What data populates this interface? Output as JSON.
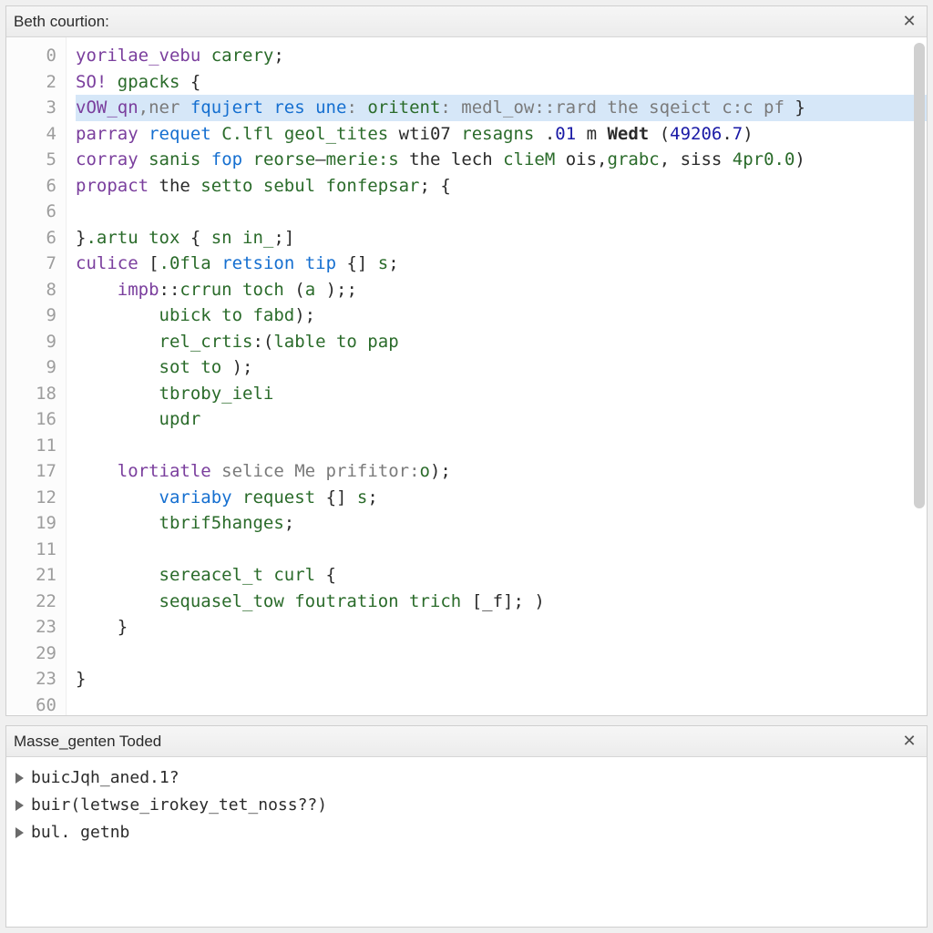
{
  "editor": {
    "title": "Beth courtion:",
    "gutter": [
      "0",
      "2",
      "3",
      "4",
      "5",
      "6",
      "6",
      "6",
      "7",
      "8",
      "9",
      "9",
      "9",
      "18",
      "16",
      "11",
      "17",
      "12",
      "19",
      "11",
      "21",
      "22",
      "23",
      "29",
      "23",
      "60"
    ],
    "lines": [
      {
        "indent": 0,
        "selected": false,
        "tokens": [
          [
            "kw",
            "yorilae_vebu"
          ],
          [
            "op",
            " "
          ],
          [
            "fn",
            "carery"
          ],
          [
            "op",
            ";"
          ]
        ]
      },
      {
        "indent": 0,
        "selected": false,
        "tokens": [
          [
            "kw",
            "SO!"
          ],
          [
            "op",
            " "
          ],
          [
            "fn",
            "gpacks"
          ],
          [
            "op",
            " {"
          ]
        ]
      },
      {
        "indent": 0,
        "selected": true,
        "tokens": [
          [
            "kw",
            "vOW_qn"
          ],
          [
            "cm",
            ",ner "
          ],
          [
            "blue",
            "fqujert res une"
          ],
          [
            "cm",
            ": "
          ],
          [
            "fn",
            "oritent"
          ],
          [
            "cm",
            ": medl_ow::rard the sqeict c:c pf "
          ],
          [
            "op",
            "}"
          ]
        ]
      },
      {
        "indent": 0,
        "selected": false,
        "tokens": [
          [
            "kw",
            "parray"
          ],
          [
            "op",
            " "
          ],
          [
            "blue",
            "requet"
          ],
          [
            "op",
            " "
          ],
          [
            "fn",
            "C.lfl geol_tites"
          ],
          [
            "op",
            " wti07 "
          ],
          [
            "fn",
            "resagns"
          ],
          [
            "op",
            " ."
          ],
          [
            "num",
            "01"
          ],
          [
            "op",
            " m "
          ],
          [
            "bold",
            "Wedt"
          ],
          [
            "op",
            " ("
          ],
          [
            "num",
            "49206"
          ],
          [
            "op",
            "."
          ],
          [
            "num",
            "7"
          ],
          [
            "op",
            ")"
          ]
        ]
      },
      {
        "indent": 0,
        "selected": false,
        "tokens": [
          [
            "kw",
            "corray"
          ],
          [
            "op",
            " "
          ],
          [
            "fn",
            "sanis"
          ],
          [
            "op",
            " "
          ],
          [
            "blue",
            "fop"
          ],
          [
            "op",
            " "
          ],
          [
            "fn",
            "reorse"
          ],
          [
            "op",
            "—"
          ],
          [
            "fn",
            "merie:s"
          ],
          [
            "op",
            " the lech "
          ],
          [
            "fn",
            "clieM"
          ],
          [
            "op",
            " ois,"
          ],
          [
            "fn",
            "grabc"
          ],
          [
            "op",
            ", siss "
          ],
          [
            "fn",
            "4pr0.0"
          ],
          [
            "op",
            ")"
          ]
        ]
      },
      {
        "indent": 0,
        "selected": false,
        "tokens": [
          [
            "kw",
            "propact"
          ],
          [
            "op",
            " the "
          ],
          [
            "fn",
            "setto sebul fonfepsar"
          ],
          [
            "op",
            "; {"
          ]
        ]
      },
      {
        "indent": 0,
        "selected": false,
        "tokens": [
          [
            "op",
            ""
          ]
        ]
      },
      {
        "indent": 0,
        "selected": false,
        "tokens": [
          [
            "op",
            "}"
          ],
          [
            "fn",
            ".artu tox"
          ],
          [
            "op",
            " { "
          ],
          [
            "fn",
            "sn in_"
          ],
          [
            "op",
            ";]"
          ]
        ]
      },
      {
        "indent": 0,
        "selected": false,
        "tokens": [
          [
            "kw",
            "culice"
          ],
          [
            "op",
            " ["
          ],
          [
            "fn",
            ".0fla"
          ],
          [
            "op",
            " "
          ],
          [
            "blue",
            "retsion tip"
          ],
          [
            "op",
            " {] "
          ],
          [
            "fn",
            "s"
          ],
          [
            "op",
            ";"
          ]
        ]
      },
      {
        "indent": 1,
        "selected": false,
        "tokens": [
          [
            "kw",
            "impb"
          ],
          [
            "op",
            "::"
          ],
          [
            "fn",
            "crrun toch"
          ],
          [
            "op",
            " ("
          ],
          [
            "fn",
            "a"
          ],
          [
            "op",
            " );;"
          ]
        ]
      },
      {
        "indent": 2,
        "selected": false,
        "tokens": [
          [
            "fn",
            "ubick to fabd"
          ],
          [
            "op",
            ");"
          ]
        ]
      },
      {
        "indent": 2,
        "selected": false,
        "tokens": [
          [
            "fn",
            "rel_crtis"
          ],
          [
            "op",
            ":("
          ],
          [
            "fn",
            "lable to pap"
          ]
        ]
      },
      {
        "indent": 2,
        "selected": false,
        "tokens": [
          [
            "fn",
            "sot to"
          ],
          [
            "op",
            " );"
          ]
        ]
      },
      {
        "indent": 2,
        "selected": false,
        "tokens": [
          [
            "fn",
            "tbroby_ieli"
          ]
        ]
      },
      {
        "indent": 2,
        "selected": false,
        "tokens": [
          [
            "fn",
            "updr"
          ]
        ]
      },
      {
        "indent": 0,
        "selected": false,
        "tokens": [
          [
            "op",
            ""
          ]
        ]
      },
      {
        "indent": 1,
        "selected": false,
        "tokens": [
          [
            "kw",
            "lortiatle"
          ],
          [
            "op",
            " "
          ],
          [
            "cm",
            "selice Me prifitor:"
          ],
          [
            "fn",
            "o"
          ],
          [
            "op",
            ");"
          ]
        ]
      },
      {
        "indent": 2,
        "selected": false,
        "tokens": [
          [
            "blue",
            "variaby"
          ],
          [
            "op",
            " "
          ],
          [
            "fn",
            "request"
          ],
          [
            "op",
            " {] "
          ],
          [
            "fn",
            "s"
          ],
          [
            "op",
            ";"
          ]
        ]
      },
      {
        "indent": 2,
        "selected": false,
        "tokens": [
          [
            "fn",
            "tbrif5hanges"
          ],
          [
            "op",
            ";"
          ]
        ]
      },
      {
        "indent": 0,
        "selected": false,
        "tokens": [
          [
            "op",
            ""
          ]
        ]
      },
      {
        "indent": 2,
        "selected": false,
        "tokens": [
          [
            "fn",
            "sereacel_t curl"
          ],
          [
            "op",
            " {"
          ]
        ]
      },
      {
        "indent": 2,
        "selected": false,
        "tokens": [
          [
            "fn",
            "sequasel_tow foutration trich"
          ],
          [
            "op",
            " [_f]; )"
          ]
        ]
      },
      {
        "indent": 1,
        "selected": false,
        "tokens": [
          [
            "op",
            "}"
          ]
        ]
      },
      {
        "indent": 0,
        "selected": false,
        "tokens": [
          [
            "op",
            ""
          ]
        ]
      },
      {
        "indent": 0,
        "selected": false,
        "tokens": [
          [
            "op",
            "}"
          ]
        ]
      },
      {
        "indent": 0,
        "selected": false,
        "tokens": [
          [
            "op",
            ""
          ]
        ]
      }
    ]
  },
  "output": {
    "title": "Masse_genten Toded",
    "rows": [
      "buicJqh_aned.1?",
      "buir(letwse_irokey_tet_noss??)",
      "bul. getnb"
    ]
  },
  "icons": {
    "close": "✕",
    "tri": "▶"
  }
}
